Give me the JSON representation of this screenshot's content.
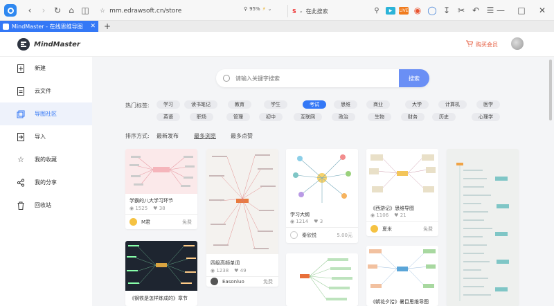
{
  "browser": {
    "url": "mm.edrawsoft.cn/store",
    "zoom": "95%",
    "search_placeholder": "在此搜索",
    "ext_badge": "LIVE"
  },
  "tab": {
    "title": "MindMaster - 在线思维导图"
  },
  "header": {
    "brand": "MindMaster",
    "vip_label": "购买会员"
  },
  "sidebar": {
    "items": [
      {
        "label": "新建",
        "icon": "new-file-icon"
      },
      {
        "label": "云文件",
        "icon": "cloud-file-icon"
      },
      {
        "label": "导图社区",
        "icon": "community-icon"
      },
      {
        "label": "导入",
        "icon": "import-icon"
      },
      {
        "label": "我的收藏",
        "icon": "star-icon"
      },
      {
        "label": "我的分享",
        "icon": "share-icon"
      },
      {
        "label": "回收站",
        "icon": "trash-icon"
      }
    ]
  },
  "search": {
    "placeholder": "请输入关键字搜索",
    "button": "搜索"
  },
  "tags": {
    "label": "热门标签:",
    "row1": [
      "学习",
      "读书笔记",
      "教育",
      "学生",
      "考试",
      "思维",
      "商业",
      "大学",
      "计算机",
      "医学"
    ],
    "row2": [
      "英语",
      "职场",
      "管理",
      "初中",
      "互联网",
      "政治",
      "生物",
      "财务",
      "历史",
      "心理学"
    ],
    "active": "考试"
  },
  "sort": {
    "label": "排序方式:",
    "options": [
      "最新发布",
      "最多浏览",
      "最多点赞"
    ],
    "active": "最多浏览"
  },
  "cards": [
    {
      "title": "学霸的八大学习环节",
      "views": "1525",
      "likes": "38",
      "author": "M君",
      "price": "免费"
    },
    {
      "title": "四级高频单词",
      "views": "1238",
      "likes": "49",
      "author": "Easonluo",
      "price": "免费"
    },
    {
      "title": "学习大纲",
      "views": "1214",
      "likes": "3",
      "author": "秦欣悦",
      "price": "5.00元"
    },
    {
      "title": "《西游记》思维导图",
      "views": "1106",
      "likes": "21",
      "author": "夏米",
      "price": "免费"
    },
    {
      "title": "《钢铁是怎样炼成的》章节",
      "views": "",
      "likes": "",
      "author": "",
      "price": ""
    },
    {
      "title": "《朝花夕拾》暑目思维导图",
      "views": "",
      "likes": "",
      "author": "",
      "price": ""
    }
  ],
  "colors": {
    "accent": "#3478f6",
    "vip": "#e55a3c",
    "search_btn": "#6a8ff5"
  }
}
